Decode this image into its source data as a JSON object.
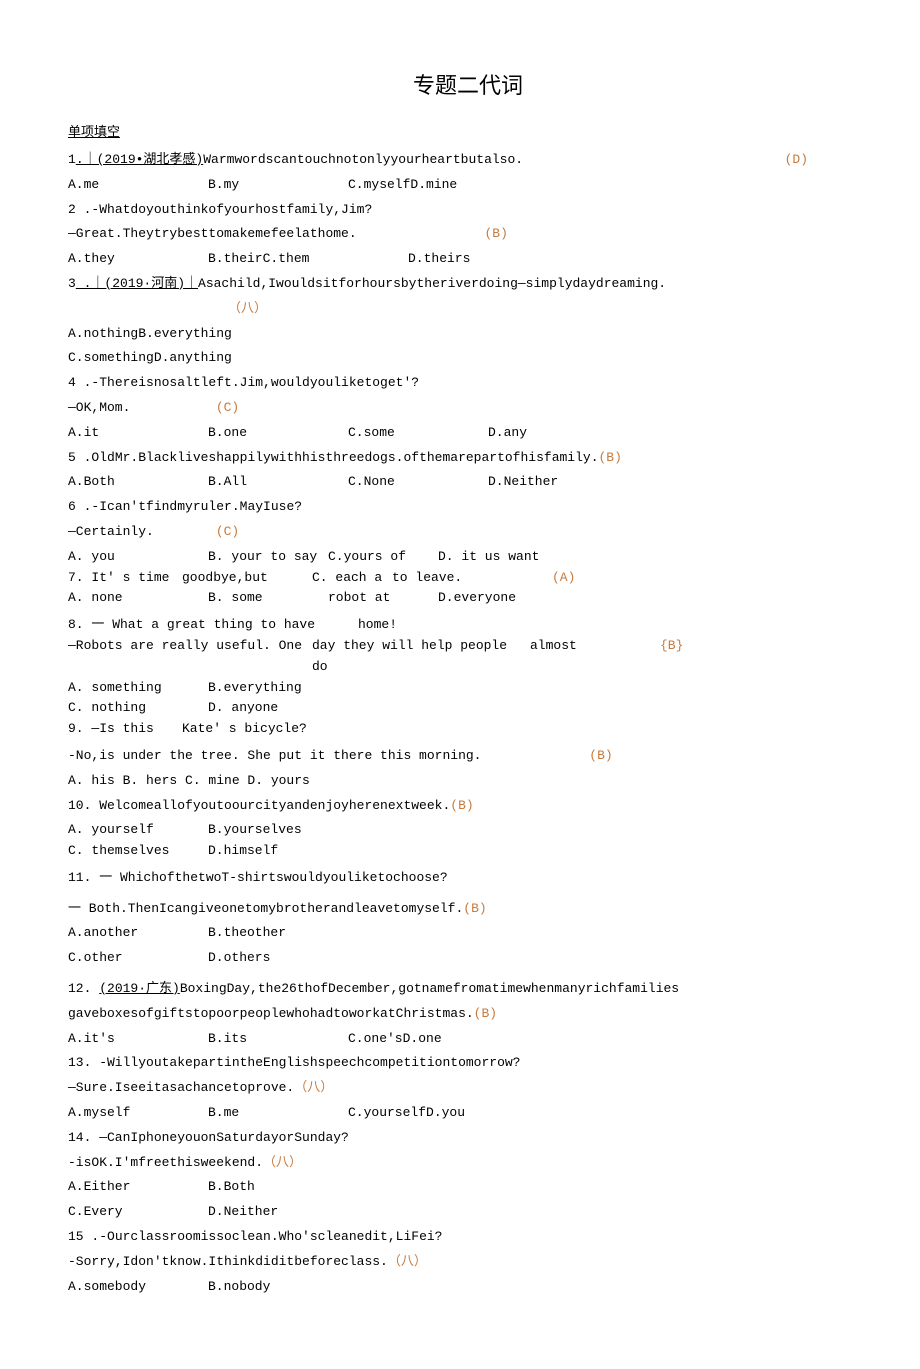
{
  "title": "专题二代词",
  "section_header": "单项填空",
  "q1": {
    "num": "1",
    "source": ".｜(2019•湖北孝感)",
    "text": "Warmwordscantouchnotonlyyourheartbutalso.",
    "ans": "(D)",
    "a": "A.me",
    "b": "B.my",
    "c": "C.myselfD.mine"
  },
  "q2": {
    "num": "2",
    "text1": " .-Whatdoyouthinkofyourhostfamily,Jim?",
    "text2": "—Great.Theytrybesttomakemefeelathome.",
    "ans": "(B)",
    "a": "A.they",
    "b": "B.theirC.them",
    "d": "D.theirs"
  },
  "q3": {
    "num": "3",
    "source": " .｜(2019·河南)｜",
    "text": "Asachild,Iwouldsitforhoursbytheriverdoing—simplydaydreaming.",
    "ans": "（八）",
    "a": "A.nothingB.everything",
    "c": "C.somethingD.anything"
  },
  "q4": {
    "num": "4",
    "text1": " .-Thereisnosaltleft.Jim,wouldyouliketoget'?",
    "text2": "—OK,Mom.",
    "ans": "(C)",
    "a": "A.it",
    "b": "B.one",
    "c": "C.some",
    "d": "D.any"
  },
  "q5": {
    "num": "5",
    "text": " .OldMr.Blackliveshappilywithhisthreedogs.ofthemarepartofhisfamily.",
    "ans": "(B)",
    "a": "A.Both",
    "b": "B.All",
    "c": "C.None",
    "d": "D.Neither"
  },
  "q6": {
    "num": "6",
    "text1": " .-Ican'tfindmyruler.MayIuse?",
    "text2": "—Certainly.",
    "ans": "(C)",
    "ra": "A. you",
    "rb": "B. your to say",
    "rc": "C.yours  of",
    "rd": "D. it us want"
  },
  "q7": {
    "text1": "7. It' s time",
    "text2": "goodbye,but",
    "text3": "C. each a",
    "text4": "to leave.",
    "ans": "(A)",
    "ra": "A. none",
    "rb": "B. some",
    "rc": "robot at",
    "rd": "D.everyone"
  },
  "q8": {
    "text1": "8. 一 What a great thing to have",
    "text2": "home!",
    "text3": "—Robots are really useful. One",
    "text4": "day they will help people do",
    "text5": "almost",
    "ans": "{B}",
    "ra": "A. something",
    "rb": "B.everything",
    "rc": "C. nothing",
    "rd": "D. anyone"
  },
  "q9": {
    "text1": "9. —Is this",
    "text2": "Kate' s bicycle?",
    "text3": "-No,is under the tree. She put it there this morning.",
    "ans": "(B)",
    "opts": "A. his         B. hers C. mine D. yours"
  },
  "q10": {
    "text": "10. Welcomeallofyoutoourcityandenjoyherenextweek.",
    "ans": "(B)",
    "ra": "A. yourself",
    "rb": "B.yourselves",
    "rc": "C. themselves",
    "rd": "D.himself"
  },
  "q11": {
    "text1": "11. 一 WhichofthetwoT-shirtswouldyouliketochoose?",
    "text2": "一 Both.ThenIcangiveonetomybrotherandleavetomyself.",
    "ans": "(B)",
    "a": "A.another",
    "b": "B.theother",
    "c": "C.other",
    "d": "D.others"
  },
  "q12": {
    "num": "12. ",
    "source": "(2019·广东)",
    "text1": "BoxingDay,the26thofDecember,gotnamefromatimewhenmanyrichfamilies",
    "text2": "gaveboxesofgiftstopoorpeoplewhohadtoworkatChristmas.",
    "ans": "(B)",
    "a": "A.it's",
    "b": "B.its",
    "c": "C.one'sD.one"
  },
  "q13": {
    "text1": "13. -WillyoutakepartintheEnglishspeechcompetitiontomorrow?",
    "text2": "—Sure.Iseeitasachancetoprove.",
    "ans": "（八）",
    "a": "A.myself",
    "b": "B.me",
    "c": "C.yourselfD.you"
  },
  "q14": {
    "text1": "14. —CanIphoneyouonSaturdayorSunday?",
    "text2": "-isOK.I'mfreethisweekend.",
    "ans": "（八）",
    "a": "A.Either",
    "b": "B.Both",
    "c": "C.Every",
    "d": "D.Neither"
  },
  "q15": {
    "num": "15",
    "text1": " .-Ourclassroomissoclean.Who'scleanedit,LiFei?",
    "text2": "-Sorry,Idon'tknow.Ithinkdiditbeforeclass.",
    "ans": "（八）",
    "a": "A.somebody",
    "b": "B.nobody"
  }
}
